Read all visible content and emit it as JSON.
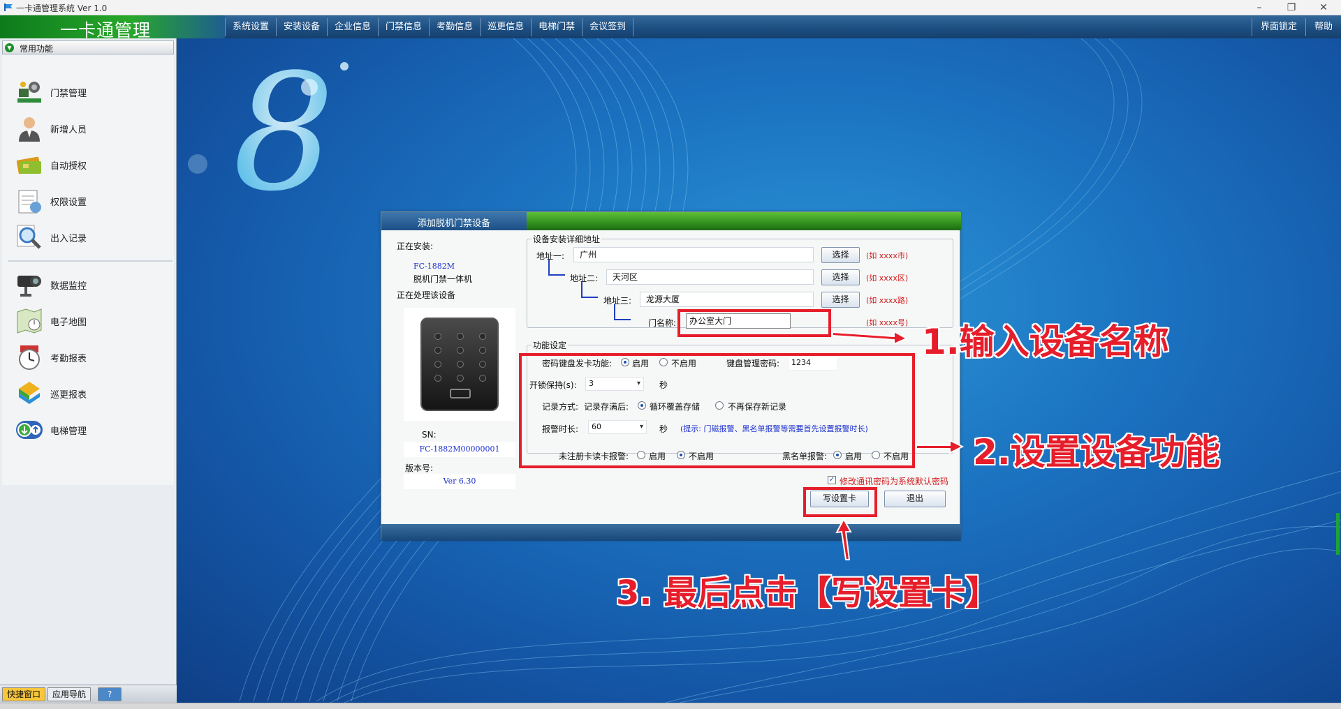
{
  "window": {
    "title": "一卡通管理系统 Ver 1.0",
    "controls": {
      "minimize": "–",
      "maximize": "❐",
      "close": "✕"
    }
  },
  "header": {
    "brand": "一卡通管理",
    "menu": [
      "系统设置",
      "安装设备",
      "企业信息",
      "门禁信息",
      "考勤信息",
      "巡更信息",
      "电梯门禁",
      "会议签到"
    ],
    "right_menu": [
      "界面锁定",
      "帮助"
    ]
  },
  "sidebar": {
    "section_title": "常用功能",
    "items": [
      {
        "label": "门禁管理",
        "icon": "access-control-icon"
      },
      {
        "label": "新增人员",
        "icon": "person-icon"
      },
      {
        "label": "自动授权",
        "icon": "card-icon"
      },
      {
        "label": "权限设置",
        "icon": "permission-icon"
      },
      {
        "label": "出入记录",
        "icon": "magnifier-icon"
      },
      {
        "label": "数据监控",
        "icon": "camera-icon"
      },
      {
        "label": "电子地图",
        "icon": "map-icon"
      },
      {
        "label": "考勤报表",
        "icon": "clock-icon"
      },
      {
        "label": "巡更报表",
        "icon": "patrol-icon"
      },
      {
        "label": "电梯管理",
        "icon": "elevator-icon"
      }
    ],
    "bottom_tabs": [
      "快捷窗口",
      "应用导航"
    ],
    "help": "?"
  },
  "dialog": {
    "title": "添加脱机门禁设备",
    "installing_label": "正在安装:",
    "model": "FC-1882M",
    "model_desc": "脱机门禁一体机",
    "processing_label": "正在处理该设备",
    "sn_label": "SN:",
    "sn_value": "FC-1882M00000001",
    "version_label": "版本号:",
    "version_value": "Ver 6.30",
    "address_group": "设备安装详细地址",
    "address1_label": "地址一:",
    "address1_value": "广州",
    "address2_label": "地址二:",
    "address2_value": "天河区",
    "address3_label": "地址三:",
    "address3_value": "龙源大厦",
    "door_label": "门名称:",
    "door_value": "办公室大门",
    "select_button": "选择",
    "hint_city": "(如 xxxx市)",
    "hint_district": "(如 xxxx区)",
    "hint_road": "(如 xxxx路)",
    "hint_number": "(如 xxxx号)",
    "function_group": "功能设定",
    "pwd_keyboard_label": "密码键盘发卡功能:",
    "enable": "启用",
    "disable": "不启用",
    "keyboard_pwd_label": "键盘管理密码:",
    "keyboard_pwd_value": "1234",
    "unlock_label": "开锁保持(s):",
    "unlock_value": "3",
    "seconds": "秒",
    "record_label": "记录方式:",
    "record_full_label": "记录存满后:",
    "record_opt1": "循环覆盖存储",
    "record_opt2": "不再保存新记录",
    "alarm_label": "报警时长:",
    "alarm_value": "60",
    "alarm_hint": "(提示: 门磁报警、黑名单报警等需要首先设置报警时长)",
    "unreg_alarm_label": "未注册卡读卡报警:",
    "blacklist_alarm_label": "黑名单报警:",
    "default_pwd_checkbox": "修改通讯密码为系统默认密码",
    "write_button": "写设置卡",
    "exit_button": "退出"
  },
  "annotations": {
    "step1": "1.输入设备名称",
    "step2": "2.设置设备功能",
    "step3": "3. 最后点击【写设置卡】"
  },
  "colors": {
    "annotation_red": "#e61e2b",
    "header_blue": "#1d4f82",
    "brand_green": "#28a82a"
  }
}
